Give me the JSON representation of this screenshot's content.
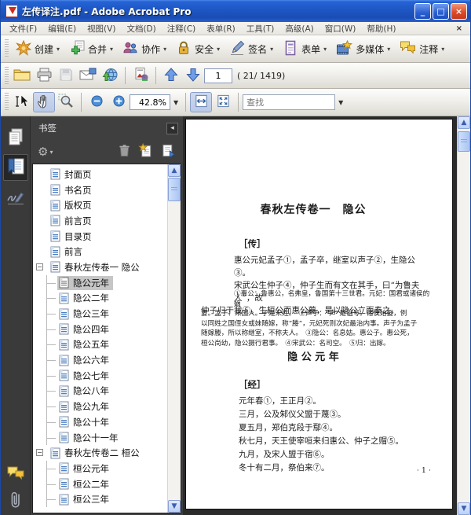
{
  "window": {
    "title": "左传译注.pdf - Adobe Acrobat Pro",
    "controls": {
      "minimize": "_",
      "maximize": "□",
      "close": "×"
    }
  },
  "menubar": {
    "items": [
      "文件(F)",
      "编辑(E)",
      "视图(V)",
      "文档(D)",
      "注释(C)",
      "表单(R)",
      "工具(T)",
      "高级(A)",
      "窗口(W)",
      "帮助(H)"
    ],
    "close_label": "×"
  },
  "task_toolbar": {
    "buttons": [
      {
        "label": "创建",
        "icon": "create-icon"
      },
      {
        "label": "合并",
        "icon": "combine-icon"
      },
      {
        "label": "协作",
        "icon": "collaborate-icon"
      },
      {
        "label": "安全",
        "icon": "secure-icon"
      },
      {
        "label": "签名",
        "icon": "sign-icon"
      },
      {
        "label": "表单",
        "icon": "forms-icon"
      },
      {
        "label": "多媒体",
        "icon": "multimedia-icon"
      },
      {
        "label": "注释",
        "icon": "comment-icon"
      }
    ]
  },
  "file_toolbar": {
    "page_value": "1",
    "page_info": "( 21/ 1419)"
  },
  "view_toolbar": {
    "zoom_value": "42.8%",
    "find_placeholder": "查找"
  },
  "nav_panel": {
    "title": "书签",
    "bookmarks": [
      {
        "label": "封面页",
        "level": 0
      },
      {
        "label": "书名页",
        "level": 0
      },
      {
        "label": "版权页",
        "level": 0
      },
      {
        "label": "前言页",
        "level": 0
      },
      {
        "label": "目录页",
        "level": 0
      },
      {
        "label": "前言",
        "level": 0
      },
      {
        "label": "春秋左传卷一 隐公",
        "level": 0,
        "expanded": true
      },
      {
        "label": "隐公元年",
        "level": 1,
        "selected": true
      },
      {
        "label": "隐公二年",
        "level": 1
      },
      {
        "label": "隐公三年",
        "level": 1
      },
      {
        "label": "隐公四年",
        "level": 1
      },
      {
        "label": "隐公五年",
        "level": 1
      },
      {
        "label": "隐公六年",
        "level": 1
      },
      {
        "label": "隐公七年",
        "level": 1
      },
      {
        "label": "隐公八年",
        "level": 1
      },
      {
        "label": "隐公九年",
        "level": 1
      },
      {
        "label": "隐公十年",
        "level": 1
      },
      {
        "label": "隐公十一年",
        "level": 1
      },
      {
        "label": "春秋左传卷二 桓公",
        "level": 0,
        "expanded": true
      },
      {
        "label": "桓公元年",
        "level": 1
      },
      {
        "label": "桓公二年",
        "level": 1
      },
      {
        "label": "桓公三年",
        "level": 1
      }
    ]
  },
  "document": {
    "chapter_title": "春秋左传卷一　隐公",
    "zhuan_label": "［传］",
    "zhuan_lines": [
      {
        "text": "惠公元妃孟子①，孟子卒，继室以声子②，生隐公③。",
        "indent": true
      },
      {
        "text": "宋武公生仲子④，仲子生而有文在其手，曰“为鲁夫人”，故",
        "indent": true
      },
      {
        "text": "仲子归于我⑤。生桓公而惠公薨，是以隐公立而奉之。",
        "indent": false
      }
    ],
    "annotation_lines": [
      {
        "text": "①惠公：鲁惠公，名弗皇，鲁国第十三世君。元妃：国君或诸侯的嫡",
        "indent": true
      },
      {
        "text": "妻。孟子：宋国人。子是宋姓。　②声子：“声”是谥号。诸侯始娶，例",
        "indent": false
      },
      {
        "text": "以同姓之国侄女或妹随嫁，称“媵”，元妃死则次妃最治内事。声子为孟子",
        "indent": false
      },
      {
        "text": "随嫁媵，所以称继室，不称夫人。　③隐公：名息姑。惠公子。惠公死，",
        "indent": false
      },
      {
        "text": "桓公尚幼，隐公摄行君事。　④宋武公：名司空。　⑤归：出嫁。",
        "indent": false
      }
    ],
    "section_title": "隐 公 元 年",
    "jing_label": "［经］",
    "jing_lines": [
      "元年春①，王正月②。",
      "三月，公及邾仪父盟于蔑③。",
      "夏五月，郑伯克段于鄢④。",
      "秋七月，天王使宰咺来归惠公、仲子之赗⑤。",
      "九月，及宋人盟于宿⑥。",
      "冬十有二月，祭伯来⑦。"
    ],
    "page_number": "· 1 ·"
  }
}
